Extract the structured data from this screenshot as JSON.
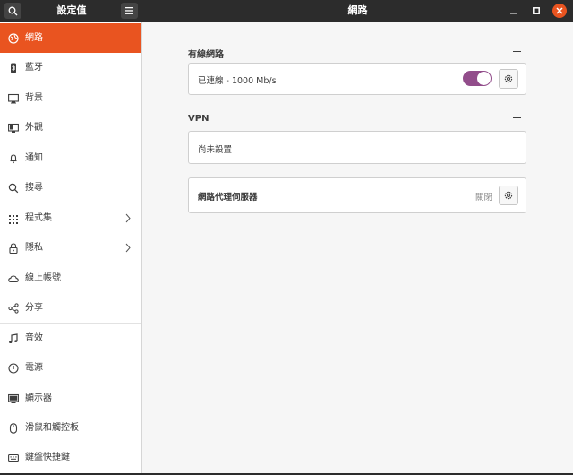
{
  "header": {
    "left_title": "設定值",
    "main_title": "網路"
  },
  "sidebar": {
    "items": [
      {
        "label": "網路",
        "icon": "network-icon"
      },
      {
        "label": "藍牙",
        "icon": "bluetooth-icon"
      },
      {
        "label": "背景",
        "icon": "background-icon"
      },
      {
        "label": "外觀",
        "icon": "appearance-icon"
      },
      {
        "label": "通知",
        "icon": "bell-icon"
      },
      {
        "label": "搜尋",
        "icon": "search-icon"
      },
      {
        "label": "程式集",
        "icon": "apps-grid-icon"
      },
      {
        "label": "隱私",
        "icon": "lock-icon"
      },
      {
        "label": "線上帳號",
        "icon": "cloud-icon"
      },
      {
        "label": "分享",
        "icon": "share-icon"
      },
      {
        "label": "音效",
        "icon": "music-note-icon"
      },
      {
        "label": "電源",
        "icon": "power-icon"
      },
      {
        "label": "顯示器",
        "icon": "monitor-icon"
      },
      {
        "label": "滑鼠和觸控板",
        "icon": "mouse-icon"
      },
      {
        "label": "鍵盤快捷鍵",
        "icon": "keyboard-icon"
      }
    ]
  },
  "wired": {
    "title": "有線網路",
    "status": "已連線 - 1000 Mb/s",
    "toggle_on": true
  },
  "vpn": {
    "title": "VPN",
    "empty_text": "尚未設置"
  },
  "proxy": {
    "title": "網路代理伺服器",
    "status": "關閉"
  },
  "colors": {
    "accent": "#e95420",
    "toggle": "#924d8b",
    "titlebar": "#2c2c2c"
  }
}
